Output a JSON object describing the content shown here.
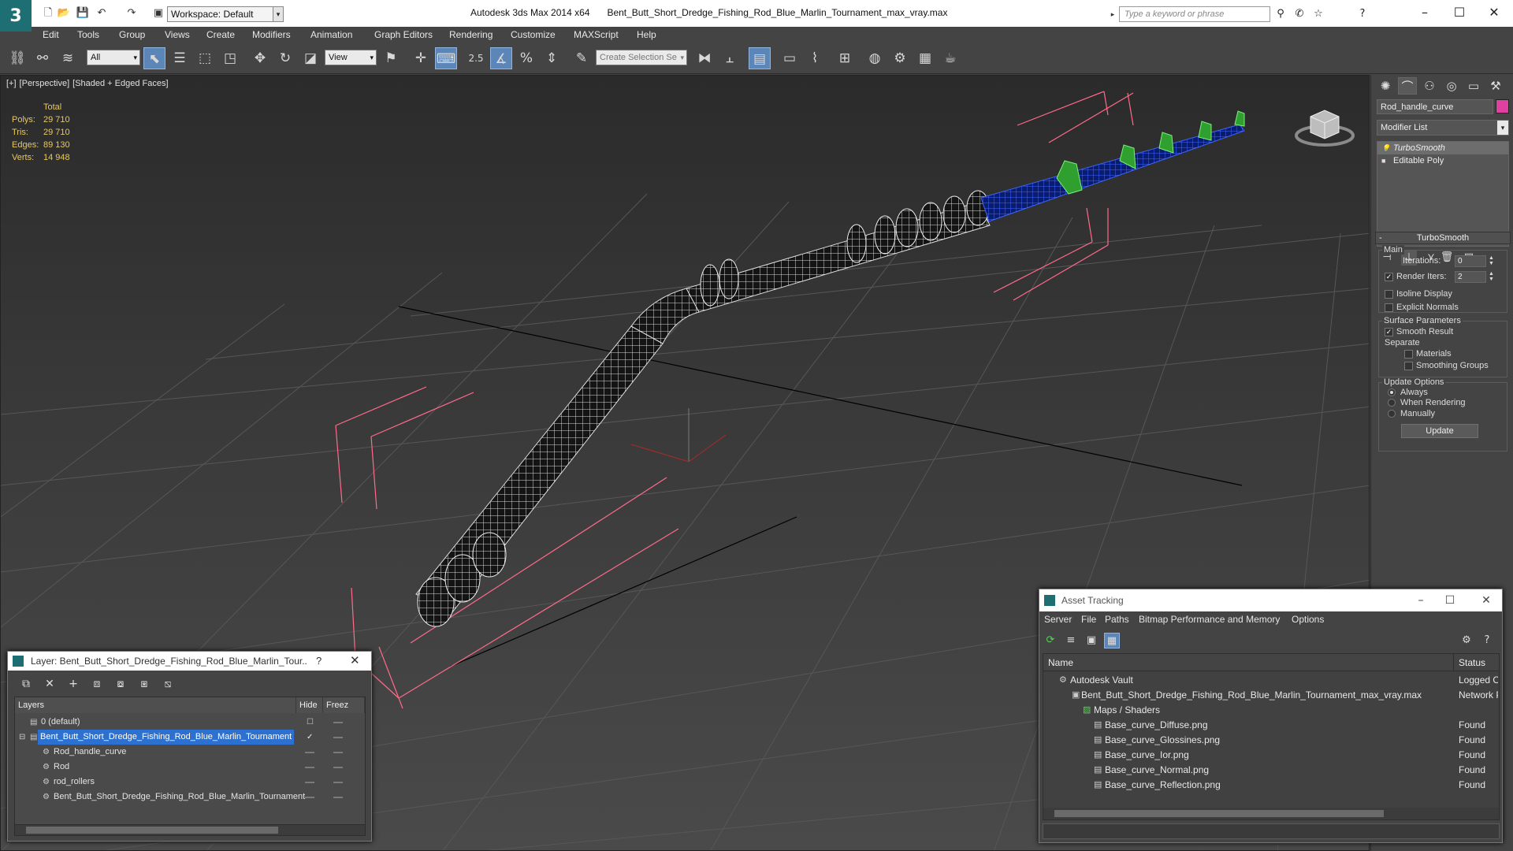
{
  "titlebar": {
    "workspace": "Workspace: Default",
    "app_name": "Autodesk 3ds Max  2014 x64",
    "file_name": "Bent_Butt_Short_Dredge_Fishing_Rod_Blue_Marlin_Tournament_max_vray.max",
    "search_placeholder": "Type a keyword or phrase"
  },
  "menu": [
    "Edit",
    "Tools",
    "Group",
    "Views",
    "Create",
    "Modifiers",
    "Animation",
    "Graph Editors",
    "Rendering",
    "Customize",
    "MAXScript",
    "Help"
  ],
  "toolbar": {
    "selection_filter": "All",
    "ref_coord": "View",
    "snap_angle_label": "2.5",
    "selection_set_placeholder": "Create Selection Se"
  },
  "viewport": {
    "label_plus": "[+]",
    "label_view": "[Perspective]",
    "label_shading": "[Shaded + Edged Faces]",
    "stats": {
      "header": "Total",
      "rows": [
        {
          "label": "Polys:",
          "value": "29 710"
        },
        {
          "label": "Tris:",
          "value": "29 710"
        },
        {
          "label": "Edges:",
          "value": "89 130"
        },
        {
          "label": "Verts:",
          "value": "14 948"
        }
      ]
    }
  },
  "command_panel": {
    "object_name": "Rod_handle_curve",
    "object_color": "#e040a0",
    "modifier_list": "Modifier List",
    "stack": [
      "TurboSmooth",
      "Editable Poly"
    ],
    "rollout_title": "TurboSmooth",
    "main_group": "Main",
    "iterations_label": "Iterations:",
    "iterations_value": "0",
    "render_iters_label": "Render Iters:",
    "render_iters_value": "2",
    "render_iters_checked": true,
    "isoline_label": "Isoline Display",
    "explicit_normals_label": "Explicit Normals",
    "surface_group": "Surface Parameters",
    "smooth_result_label": "Smooth Result",
    "separate_label": "Separate",
    "materials_label": "Materials",
    "smoothing_groups_label": "Smoothing Groups",
    "update_group": "Update Options",
    "radio_always": "Always",
    "radio_when_rendering": "When Rendering",
    "radio_manually": "Manually",
    "update_button": "Update"
  },
  "layer_dialog": {
    "title": "Layer: Bent_Butt_Short_Dredge_Fishing_Rod_Blue_Marlin_Tour...",
    "help": "?",
    "col_layers": "Layers",
    "col_hide": "Hide",
    "col_freeze": "Freez",
    "rows": [
      {
        "name": "0 (default)"
      },
      {
        "name": "Bent_Butt_Short_Dredge_Fishing_Rod_Blue_Marlin_Tournament"
      },
      {
        "name": "Rod_handle_curve"
      },
      {
        "name": "Rod"
      },
      {
        "name": "rod_rollers"
      },
      {
        "name": "Bent_Butt_Short_Dredge_Fishing_Rod_Blue_Marlin_Tournament"
      }
    ]
  },
  "asset_dialog": {
    "title": "Asset Tracking",
    "menu": [
      "Server",
      "File",
      "Paths",
      "Bitmap Performance and Memory",
      "Options"
    ],
    "col_name": "Name",
    "col_status": "Status",
    "rows": [
      {
        "name": "Autodesk Vault",
        "status": "Logged Ou"
      },
      {
        "name": "Bent_Butt_Short_Dredge_Fishing_Rod_Blue_Marlin_Tournament_max_vray.max",
        "status": "Network Pa"
      },
      {
        "name": "Maps / Shaders",
        "status": ""
      },
      {
        "name": "Base_curve_Diffuse.png",
        "status": "Found"
      },
      {
        "name": "Base_curve_Glossines.png",
        "status": "Found"
      },
      {
        "name": "Base_curve_Ior.png",
        "status": "Found"
      },
      {
        "name": "Base_curve_Normal.png",
        "status": "Found"
      },
      {
        "name": "Base_curve_Reflection.png",
        "status": "Found"
      }
    ]
  }
}
